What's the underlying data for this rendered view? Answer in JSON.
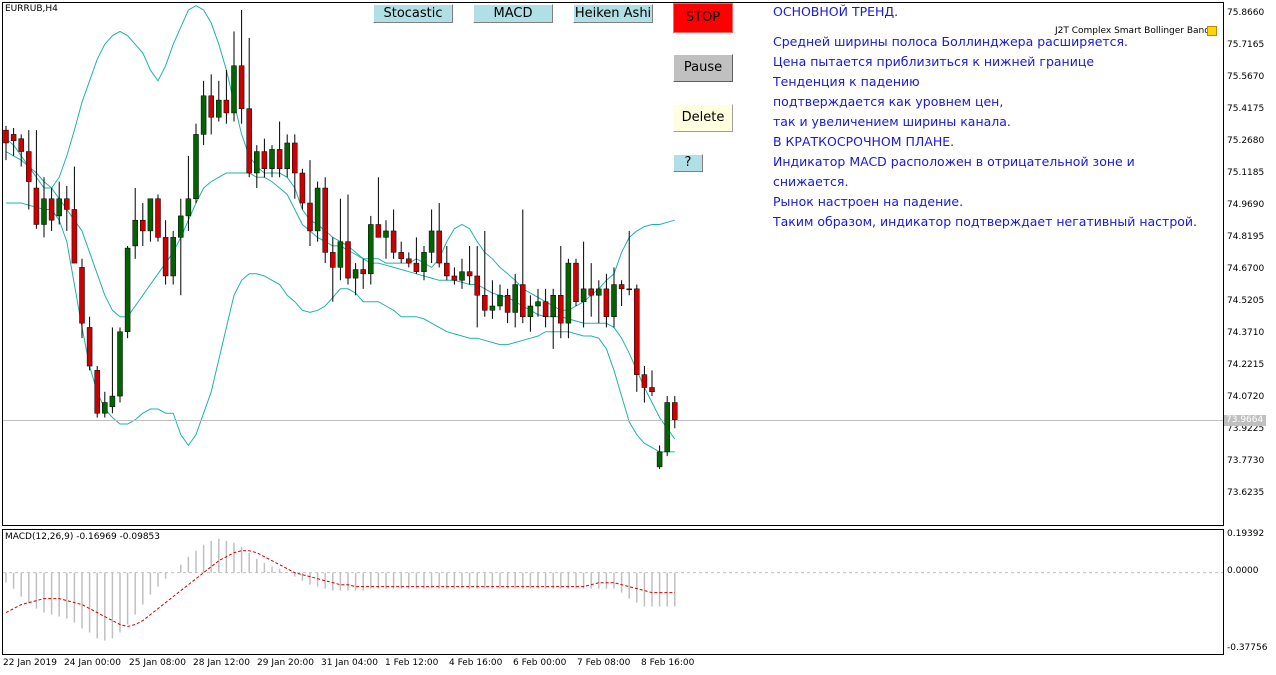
{
  "chart": {
    "symbol_label": "EURRUB,H4",
    "indicator_label": "J2T Complex Smart Bollinger Bands",
    "current_price": "73.9664",
    "price_ticks": [
      "75.8660",
      "75.7165",
      "75.5670",
      "75.4175",
      "75.2680",
      "75.1185",
      "74.9690",
      "74.8195",
      "74.6700",
      "74.5205",
      "74.3710",
      "74.2215",
      "74.0720",
      "73.9225",
      "73.7730",
      "73.6235"
    ],
    "time_ticks": [
      "22 Jan 2019",
      "24 Jan 00:00",
      "25 Jan 08:00",
      "28 Jan 12:00",
      "29 Jan 20:00",
      "31 Jan 04:00",
      "1 Feb 12:00",
      "4 Feb 16:00",
      "6 Feb 00:00",
      "7 Feb 08:00",
      "8 Feb 16:00"
    ]
  },
  "macd": {
    "label": "MACD(12,26,9) -0.16969 -0.09853",
    "ticks": [
      "0.19392",
      "0.0000",
      "-0.37756"
    ]
  },
  "buttons": {
    "stocastic": "Stocastic",
    "macd": "MACD",
    "heiken": "Heiken Ashi",
    "stop": "STOP",
    "pause": "Pause",
    "delete": "Delete",
    "help": "?"
  },
  "comment": {
    "lines": [
      "ОСНОВНОЙ ТРЕНД.",
      "Средней ширины полоса Боллинджера расширяется.",
      "Цена пытается приблизиться к нижней границе",
      "Тенденция к падению",
      "подтверждается как уровнем цен,",
      "так и увеличением ширины канала.",
      "В КРАТКОСРОЧНОМ ПЛАНЕ.",
      "Индикатор MACD расположен в отрицательной зоне и",
      "снижается.",
      "Рынок настроен на падение.",
      "Таким образом, индикатор подтверждает негативный настрой."
    ]
  },
  "colors": {
    "bull": "#006400",
    "bear": "#cc0000",
    "bands": "#20b2aa",
    "macd_hist": "#c0c0c0",
    "macd_signal": "#cc0000"
  },
  "candles": [
    [
      75.32,
      75.34,
      75.18,
      75.26
    ],
    [
      75.3,
      75.33,
      75.2,
      75.27
    ],
    [
      75.28,
      75.3,
      75.15,
      75.22
    ],
    [
      75.22,
      75.32,
      74.95,
      75.08
    ],
    [
      75.05,
      75.32,
      74.86,
      74.88
    ],
    [
      74.88,
      75.1,
      74.82,
      75.0
    ],
    [
      75.0,
      75.05,
      74.85,
      74.9
    ],
    [
      74.92,
      75.08,
      74.88,
      75.0
    ],
    [
      75.0,
      75.06,
      74.85,
      74.95
    ],
    [
      74.95,
      75.15,
      74.7,
      74.7
    ],
    [
      74.68,
      74.72,
      74.35,
      74.42
    ],
    [
      74.4,
      74.45,
      74.2,
      74.22
    ],
    [
      74.2,
      74.22,
      73.98,
      74.0
    ],
    [
      74.0,
      74.1,
      73.98,
      74.05
    ],
    [
      74.03,
      74.4,
      74.0,
      74.08
    ],
    [
      74.08,
      74.4,
      74.05,
      74.38
    ],
    [
      74.38,
      74.78,
      74.35,
      74.77
    ],
    [
      74.78,
      75.05,
      74.72,
      74.9
    ],
    [
      74.9,
      74.98,
      74.78,
      74.85
    ],
    [
      74.85,
      75.0,
      74.8,
      75.0
    ],
    [
      75.0,
      75.02,
      74.8,
      74.82
    ],
    [
      74.82,
      74.9,
      74.6,
      74.64
    ],
    [
      74.64,
      74.85,
      74.6,
      74.82
    ],
    [
      74.82,
      75.0,
      74.55,
      74.92
    ],
    [
      74.92,
      75.2,
      74.85,
      75.0
    ],
    [
      75.0,
      75.35,
      74.98,
      75.3
    ],
    [
      75.3,
      75.55,
      75.25,
      75.48
    ],
    [
      75.48,
      75.58,
      75.3,
      75.38
    ],
    [
      75.38,
      75.55,
      75.36,
      75.46
    ],
    [
      75.46,
      75.6,
      75.35,
      75.4
    ],
    [
      75.4,
      75.78,
      75.36,
      75.62
    ],
    [
      75.62,
      75.88,
      75.35,
      75.42
    ],
    [
      75.42,
      75.75,
      75.1,
      75.12
    ],
    [
      75.12,
      75.25,
      75.05,
      75.22
    ],
    [
      75.22,
      75.28,
      75.1,
      75.14
    ],
    [
      75.14,
      75.25,
      75.1,
      75.23
    ],
    [
      75.23,
      75.36,
      75.1,
      75.14
    ],
    [
      75.14,
      75.3,
      75.1,
      75.26
    ],
    [
      75.26,
      75.3,
      75.0,
      75.12
    ],
    [
      75.12,
      75.14,
      74.95,
      74.98
    ],
    [
      74.98,
      75.18,
      74.78,
      74.85
    ],
    [
      74.85,
      75.08,
      74.8,
      75.05
    ],
    [
      75.05,
      75.1,
      74.7,
      74.75
    ],
    [
      74.75,
      74.82,
      74.52,
      74.68
    ],
    [
      74.68,
      75.0,
      74.62,
      74.8
    ],
    [
      74.8,
      75.02,
      74.6,
      74.63
    ],
    [
      74.63,
      74.7,
      74.55,
      74.67
    ],
    [
      74.67,
      74.72,
      74.58,
      74.65
    ],
    [
      74.65,
      74.92,
      74.6,
      74.88
    ],
    [
      74.88,
      75.1,
      74.82,
      74.82
    ],
    [
      74.82,
      74.9,
      74.72,
      74.85
    ],
    [
      74.85,
      74.95,
      74.72,
      74.75
    ],
    [
      74.75,
      74.8,
      74.7,
      74.72
    ],
    [
      74.72,
      74.75,
      74.68,
      74.7
    ],
    [
      74.7,
      74.82,
      74.65,
      74.66
    ],
    [
      74.66,
      74.78,
      74.62,
      74.75
    ],
    [
      74.75,
      74.95,
      74.7,
      74.85
    ],
    [
      74.85,
      74.98,
      74.68,
      74.7
    ],
    [
      74.7,
      74.78,
      74.62,
      74.64
    ],
    [
      74.64,
      74.68,
      74.6,
      74.62
    ],
    [
      74.62,
      74.72,
      74.58,
      74.66
    ],
    [
      74.66,
      74.78,
      74.6,
      74.64
    ],
    [
      74.64,
      74.78,
      74.4,
      74.55
    ],
    [
      74.55,
      74.85,
      74.45,
      74.48
    ],
    [
      74.48,
      74.62,
      74.44,
      74.5
    ],
    [
      74.5,
      74.6,
      74.48,
      74.55
    ],
    [
      74.55,
      74.58,
      74.42,
      74.47
    ],
    [
      74.47,
      74.65,
      74.4,
      74.6
    ],
    [
      74.6,
      74.95,
      74.42,
      74.45
    ],
    [
      74.45,
      74.55,
      74.38,
      74.5
    ],
    [
      74.5,
      74.58,
      74.45,
      74.52
    ],
    [
      74.52,
      74.58,
      74.4,
      74.45
    ],
    [
      74.45,
      74.58,
      74.3,
      74.55
    ],
    [
      74.55,
      74.78,
      74.35,
      74.42
    ],
    [
      74.42,
      74.72,
      74.35,
      74.7
    ],
    [
      74.7,
      74.72,
      74.5,
      74.52
    ],
    [
      74.52,
      74.8,
      74.4,
      74.58
    ],
    [
      74.58,
      74.7,
      74.45,
      74.55
    ],
    [
      74.55,
      74.62,
      74.42,
      74.58
    ],
    [
      74.58,
      74.65,
      74.4,
      74.45
    ],
    [
      74.45,
      74.68,
      74.4,
      74.6
    ],
    [
      74.6,
      74.62,
      74.5,
      74.58
    ],
    [
      74.58,
      74.85,
      74.55,
      74.58
    ],
    [
      74.58,
      74.6,
      74.1,
      74.18
    ],
    [
      74.18,
      74.22,
      74.05,
      74.12
    ],
    [
      74.12,
      74.2,
      74.08,
      74.1
    ],
    [
      73.75,
      73.85,
      73.74,
      73.82
    ],
    [
      73.82,
      74.08,
      73.8,
      74.05
    ],
    [
      74.05,
      74.08,
      73.93,
      73.97
    ]
  ],
  "bands": {
    "upper": [
      75.28,
      75.25,
      75.2,
      75.15,
      75.1,
      75.05,
      75.05,
      75.1,
      75.2,
      75.32,
      75.45,
      75.55,
      75.65,
      75.72,
      75.76,
      75.78,
      75.76,
      75.72,
      75.68,
      75.6,
      75.55,
      75.62,
      75.72,
      75.8,
      75.88,
      75.9,
      75.88,
      75.82,
      75.72,
      75.6,
      75.45,
      75.3,
      75.2,
      75.15,
      75.12,
      75.12,
      75.12,
      75.1,
      75.05,
      74.95,
      74.9,
      74.88,
      74.85,
      74.82,
      74.8,
      74.78,
      74.75,
      74.72,
      74.72,
      74.72,
      74.7,
      74.7,
      74.7,
      74.7,
      74.72,
      74.7,
      74.68,
      74.72,
      74.8,
      74.86,
      74.88,
      74.86,
      74.8,
      74.75,
      74.72,
      74.68,
      74.65,
      74.62,
      74.58,
      74.56,
      74.54,
      74.52,
      74.5,
      74.48,
      74.48,
      74.5,
      74.52,
      74.55,
      74.58,
      74.62,
      74.65,
      74.75,
      74.82,
      74.85,
      74.87,
      74.88,
      74.88,
      74.89,
      74.9
    ],
    "middle": [
      75.22,
      75.2,
      75.18,
      75.15,
      75.12,
      75.08,
      75.05,
      75.0,
      74.95,
      74.9,
      74.85,
      74.75,
      74.65,
      74.55,
      74.48,
      74.45,
      74.45,
      74.5,
      74.55,
      74.6,
      74.65,
      74.7,
      74.75,
      74.82,
      74.9,
      74.98,
      75.05,
      75.08,
      75.1,
      75.12,
      75.12,
      75.12,
      75.12,
      75.1,
      75.1,
      75.08,
      75.05,
      75.02,
      74.95,
      74.88,
      74.85,
      74.82,
      74.8,
      74.78,
      74.78,
      74.76,
      74.74,
      74.72,
      74.7,
      74.7,
      74.69,
      74.68,
      74.67,
      74.66,
      74.65,
      74.64,
      74.63,
      74.62,
      74.62,
      74.62,
      74.61,
      74.6,
      74.6,
      74.58,
      74.56,
      74.55,
      74.54,
      74.52,
      74.5,
      74.48,
      74.46,
      74.45,
      74.45,
      74.45,
      74.44,
      74.43,
      74.42,
      74.42,
      74.42,
      74.42,
      74.4,
      74.35,
      74.28,
      74.2,
      74.12,
      74.05,
      73.98,
      73.93,
      73.88
    ],
    "lower": [
      74.98,
      74.98,
      74.98,
      74.97,
      74.96,
      74.95,
      74.95,
      74.9,
      74.8,
      74.6,
      74.4,
      74.22,
      74.1,
      74.02,
      73.98,
      73.95,
      73.95,
      73.97,
      74.0,
      74.02,
      74.02,
      74.0,
      74.0,
      73.9,
      73.85,
      73.9,
      74.0,
      74.1,
      74.25,
      74.4,
      74.55,
      74.62,
      74.65,
      74.65,
      74.64,
      74.62,
      74.6,
      74.55,
      74.52,
      74.48,
      74.47,
      74.48,
      74.5,
      74.54,
      74.58,
      74.58,
      74.56,
      74.52,
      74.52,
      74.52,
      74.5,
      74.48,
      74.45,
      74.45,
      74.45,
      74.44,
      74.42,
      74.4,
      74.38,
      74.37,
      74.36,
      74.35,
      74.35,
      74.34,
      74.33,
      74.32,
      74.32,
      74.33,
      74.34,
      74.35,
      74.36,
      74.38,
      74.38,
      74.38,
      74.38,
      74.37,
      74.36,
      74.36,
      74.35,
      74.3,
      74.2,
      74.08,
      73.96,
      73.9,
      73.86,
      73.84,
      73.82,
      73.82,
      73.82
    ]
  },
  "macd_series": {
    "hist": [
      -0.05,
      -0.08,
      -0.12,
      -0.15,
      -0.18,
      -0.2,
      -0.21,
      -0.22,
      -0.23,
      -0.25,
      -0.28,
      -0.3,
      -0.33,
      -0.34,
      -0.33,
      -0.3,
      -0.26,
      -0.21,
      -0.16,
      -0.11,
      -0.07,
      -0.03,
      0.0,
      0.04,
      0.08,
      0.11,
      0.14,
      0.16,
      0.17,
      0.16,
      0.15,
      0.13,
      0.1,
      0.07,
      0.05,
      0.03,
      0.02,
      0.0,
      -0.02,
      -0.04,
      -0.06,
      -0.07,
      -0.08,
      -0.09,
      -0.09,
      -0.09,
      -0.09,
      -0.09,
      -0.08,
      -0.08,
      -0.08,
      -0.08,
      -0.08,
      -0.08,
      -0.08,
      -0.08,
      -0.08,
      -0.08,
      -0.08,
      -0.08,
      -0.08,
      -0.08,
      -0.08,
      -0.08,
      -0.08,
      -0.08,
      -0.08,
      -0.08,
      -0.08,
      -0.08,
      -0.08,
      -0.08,
      -0.08,
      -0.08,
      -0.08,
      -0.08,
      -0.08,
      -0.08,
      -0.08,
      -0.08,
      -0.08,
      -0.1,
      -0.13,
      -0.15,
      -0.17,
      -0.17,
      -0.17,
      -0.17,
      -0.17
    ],
    "signal": [
      -0.2,
      -0.18,
      -0.16,
      -0.15,
      -0.14,
      -0.13,
      -0.13,
      -0.13,
      -0.14,
      -0.15,
      -0.16,
      -0.18,
      -0.2,
      -0.22,
      -0.24,
      -0.26,
      -0.27,
      -0.26,
      -0.24,
      -0.21,
      -0.18,
      -0.15,
      -0.12,
      -0.09,
      -0.06,
      -0.03,
      0.0,
      0.03,
      0.06,
      0.08,
      0.1,
      0.11,
      0.11,
      0.1,
      0.08,
      0.06,
      0.04,
      0.02,
      0.0,
      -0.01,
      -0.02,
      -0.03,
      -0.04,
      -0.05,
      -0.06,
      -0.06,
      -0.07,
      -0.07,
      -0.07,
      -0.07,
      -0.07,
      -0.07,
      -0.07,
      -0.07,
      -0.07,
      -0.07,
      -0.07,
      -0.07,
      -0.07,
      -0.07,
      -0.07,
      -0.07,
      -0.07,
      -0.07,
      -0.07,
      -0.07,
      -0.07,
      -0.07,
      -0.07,
      -0.07,
      -0.07,
      -0.07,
      -0.07,
      -0.07,
      -0.07,
      -0.07,
      -0.07,
      -0.06,
      -0.05,
      -0.05,
      -0.05,
      -0.06,
      -0.07,
      -0.08,
      -0.09,
      -0.1,
      -0.1,
      -0.1,
      -0.1
    ]
  }
}
